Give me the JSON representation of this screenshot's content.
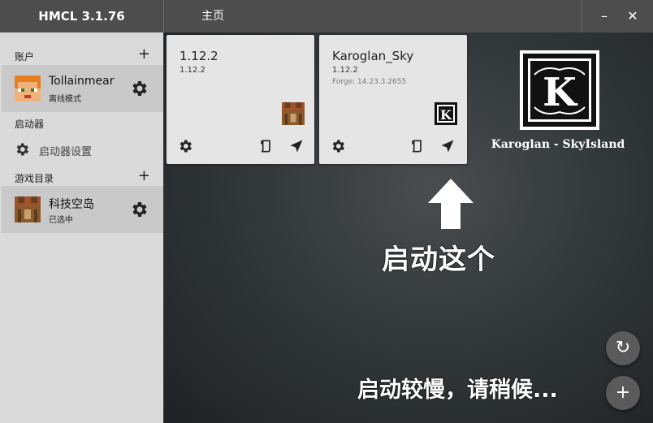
{
  "window": {
    "app_title": "HMCL 3.1.76",
    "page_title": "主页",
    "minimize_label": "–",
    "close_label": "✕"
  },
  "sidebar": {
    "accounts_header": "账户",
    "account": {
      "name": "Tollainmear",
      "mode": "离线模式"
    },
    "launcher_header": "启动器",
    "launcher_settings_label": "启动器设置",
    "game_dir_header": "游戏目录",
    "game_dir": {
      "name": "科技空岛",
      "status": "已选中"
    },
    "add_label": "+"
  },
  "cards": [
    {
      "title": "1.12.2",
      "version": "1.12.2",
      "forge": "",
      "icon": "crafting-table-icon"
    },
    {
      "title": "Karoglan_Sky",
      "version": "1.12.2",
      "forge": "Forge: 14.23.3.2655",
      "icon": "karoglan-logo-icon"
    }
  ],
  "logo_text": "Karoglan - SkyIsland",
  "launch_hint": "启动这个",
  "wait_text": "启动较慢，请稍候...",
  "fab": {
    "refresh": "↻",
    "add": "+"
  },
  "colors": {
    "titlebar": "#4d4d4d",
    "sidebar": "#dadada",
    "selected": "#c9c9c9",
    "card": "#e5e5e5"
  }
}
